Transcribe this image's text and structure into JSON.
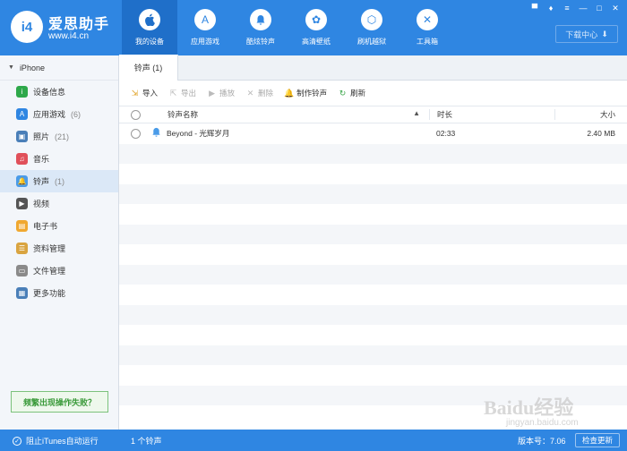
{
  "brand": {
    "name": "爱思助手",
    "url": "www.i4.cn",
    "logo": "i4"
  },
  "nav": [
    {
      "label": "我的设备",
      "icon": "apple-icon",
      "glyph": ""
    },
    {
      "label": "应用游戏",
      "icon": "appstore-icon",
      "glyph": "A"
    },
    {
      "label": "酷炫铃声",
      "icon": "bell-icon",
      "glyph": "🔔"
    },
    {
      "label": "高清壁纸",
      "icon": "flower-icon",
      "glyph": "✿"
    },
    {
      "label": "刷机越狱",
      "icon": "box-icon",
      "glyph": "⬡"
    },
    {
      "label": "工具箱",
      "icon": "tools-icon",
      "glyph": "✕"
    }
  ],
  "window_controls": [
    "▀",
    "♦",
    "≡",
    "—",
    "□",
    "✕"
  ],
  "download_center": "下载中心",
  "sidebar": {
    "device": "iPhone",
    "items": [
      {
        "label": "设备信息",
        "count": "",
        "icon": "info-icon",
        "glyph": "i",
        "color": "#2ea84a"
      },
      {
        "label": "应用游戏",
        "count": "(6)",
        "icon": "appstore-icon",
        "glyph": "A",
        "color": "#2f86e2"
      },
      {
        "label": "照片",
        "count": "(21)",
        "icon": "photo-icon",
        "glyph": "▣",
        "color": "#4a7fb8"
      },
      {
        "label": "音乐",
        "count": "",
        "icon": "music-icon",
        "glyph": "♫",
        "color": "#e0505a"
      },
      {
        "label": "铃声",
        "count": "(1)",
        "icon": "bell-icon",
        "glyph": "🔔",
        "color": "#4a9be8"
      },
      {
        "label": "视频",
        "count": "",
        "icon": "video-icon",
        "glyph": "▶",
        "color": "#555555"
      },
      {
        "label": "电子书",
        "count": "",
        "icon": "book-icon",
        "glyph": "▤",
        "color": "#f0a830"
      },
      {
        "label": "资料管理",
        "count": "",
        "icon": "contacts-icon",
        "glyph": "☰",
        "color": "#d9a440"
      },
      {
        "label": "文件管理",
        "count": "",
        "icon": "file-icon",
        "glyph": "▭",
        "color": "#8a8a8a"
      },
      {
        "label": "更多功能",
        "count": "",
        "icon": "grid-icon",
        "glyph": "▦",
        "color": "#4a7fb8"
      }
    ],
    "help_button": "频繁出现操作失败？"
  },
  "main": {
    "tab": "铃声 (1)",
    "toolbar": [
      {
        "label": "导入",
        "icon": "import-icon",
        "glyph": "⇲",
        "enabled": true
      },
      {
        "label": "导出",
        "icon": "export-icon",
        "glyph": "⇱",
        "enabled": false
      },
      {
        "label": "播放",
        "icon": "play-icon",
        "glyph": "▶",
        "enabled": false
      },
      {
        "label": "删除",
        "icon": "delete-icon",
        "glyph": "✕",
        "enabled": false
      },
      {
        "label": "制作铃声",
        "icon": "make-ringtone-icon",
        "glyph": "🔔",
        "enabled": true
      },
      {
        "label": "刷新",
        "icon": "refresh-icon",
        "glyph": "↻",
        "enabled": true
      }
    ],
    "columns": {
      "name": "铃声名称",
      "duration": "时长",
      "size": "大小"
    },
    "rows": [
      {
        "name": "Beyond - 光辉岁月",
        "duration": "02:33",
        "size": "2.40 MB"
      }
    ]
  },
  "status": {
    "itunes": "阻止iTunes自动运行",
    "count": "1 个铃声",
    "version": "版本号：7.06",
    "update_button": "检查更新"
  },
  "watermark": {
    "text": "Baidu经验",
    "url": "jingyan.baidu.com"
  }
}
